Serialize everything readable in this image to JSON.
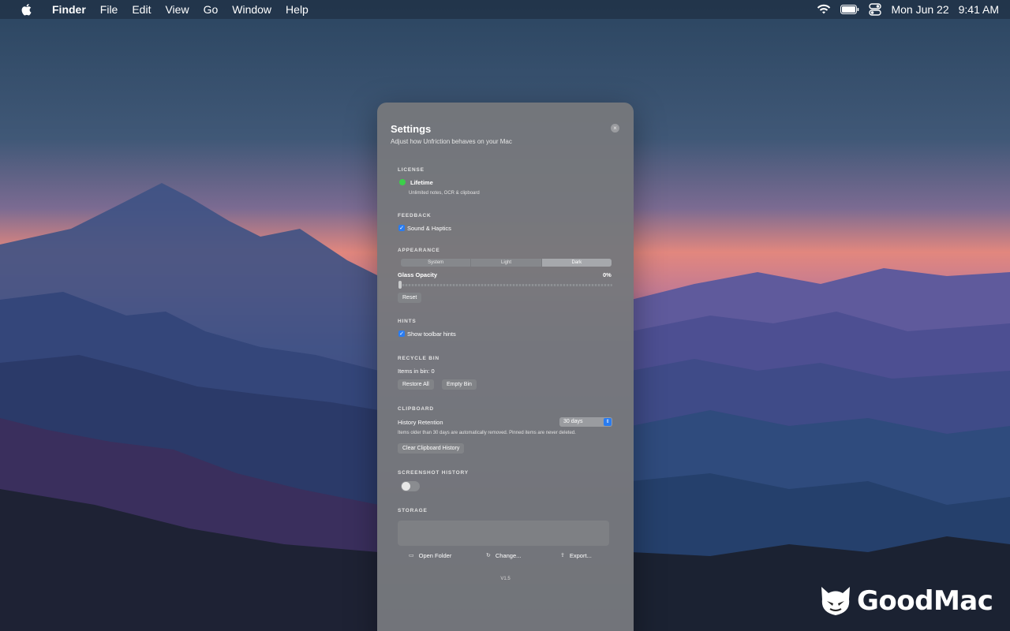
{
  "menubar": {
    "app_name": "Finder",
    "menus": [
      "File",
      "Edit",
      "View",
      "Go",
      "Window"
    ],
    "help": "Help",
    "date": "Mon Jun 22",
    "time": "9:41 AM"
  },
  "settings": {
    "title": "Settings",
    "subtitle": "Adjust how Unfriction behaves on your Mac",
    "close_icon": "close-icon",
    "license": {
      "label": "LICENSE",
      "status": "Lifetime",
      "status_color": "#3bd04a",
      "description": "Unlimited notes, OCR & clipboard"
    },
    "feedback": {
      "label": "FEEDBACK",
      "sound_haptics": "Sound & Haptics",
      "sound_haptics_checked": true
    },
    "appearance": {
      "label": "APPEARANCE",
      "modes": [
        "System",
        "Light",
        "Dark"
      ],
      "selected_mode": "Dark",
      "glass_opacity_label": "Glass Opacity",
      "glass_opacity_value": "0%",
      "glass_opacity_fraction": 0,
      "reset": "Reset"
    },
    "hints": {
      "label": "HINTS",
      "show_toolbar_hints": "Show toolbar hints",
      "show_toolbar_hints_checked": true
    },
    "recycle_bin": {
      "label": "RECYCLE BIN",
      "items_in_bin": "Items in bin: 0",
      "restore_all": "Restore All",
      "empty_bin": "Empty Bin"
    },
    "clipboard": {
      "label": "CLIPBOARD",
      "history_retention_label": "History Retention",
      "history_retention_value": "30 days",
      "note": "Items older than 30 days are automatically removed. Pinned items are never deleted.",
      "clear_history": "Clear Clipboard History"
    },
    "screenshot_history": {
      "label": "SCREENSHOT HISTORY",
      "enabled": false
    },
    "storage": {
      "label": "STORAGE",
      "open_folder": "Open Folder",
      "change": "Change...",
      "export": "Export..."
    },
    "version": "V1.5"
  },
  "watermark": {
    "brand": "GoodMac"
  }
}
